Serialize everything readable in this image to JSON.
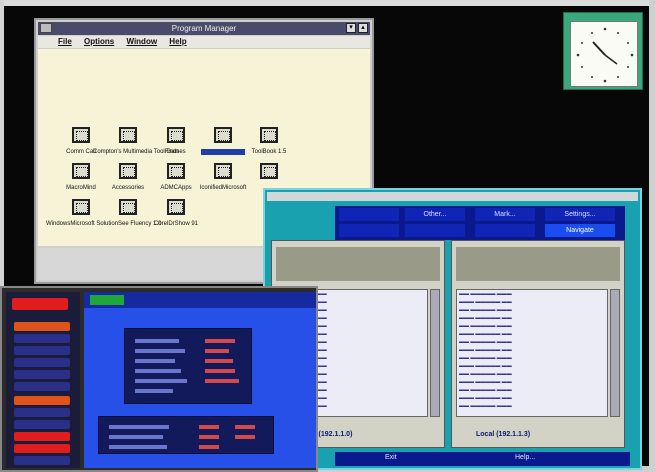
{
  "program_manager": {
    "title": "Program Manager",
    "menu": [
      "File",
      "Options",
      "Window",
      "Help"
    ],
    "icons": [
      {
        "label": "Comm Call",
        "selected": false
      },
      {
        "label": "Compton's Multimedia ToolFinds",
        "selected": false
      },
      {
        "label": "Games",
        "selected": false
      },
      {
        "label": "",
        "selected": true
      },
      {
        "label": "ToolBook 1.5",
        "selected": false
      },
      {
        "label": "MacroMind",
        "selected": false
      },
      {
        "label": "Accessories",
        "selected": false
      },
      {
        "label": "ADMCApps",
        "selected": false
      },
      {
        "label": "IconifiedMicrosoft",
        "selected": false
      },
      {
        "label": "",
        "selected": false
      },
      {
        "label": "WindowsMicrosoft SolutionSee Fluency 1.0",
        "selected": false
      },
      {
        "label": "",
        "selected": false
      },
      {
        "label": "CorelDrShow 91",
        "selected": false
      }
    ]
  },
  "nc_window": {
    "buttons": [
      "Other...",
      "Mark...",
      "Settings...",
      "Navigate"
    ],
    "left_panel_footer": "public (192.1.1.0)",
    "right_panel_footer": "Local (192.1.1.3)",
    "bottom": {
      "left": "Exit",
      "right": "Help..."
    }
  },
  "colors": {
    "pm_workspace": "#f7f3d6",
    "selection": "#1e3fa8",
    "nc_background": "#1aa1b0",
    "nc_buttons": "#0a1a8c",
    "dos_blue": "#2750e8",
    "dos_red": "#e01c1c"
  }
}
